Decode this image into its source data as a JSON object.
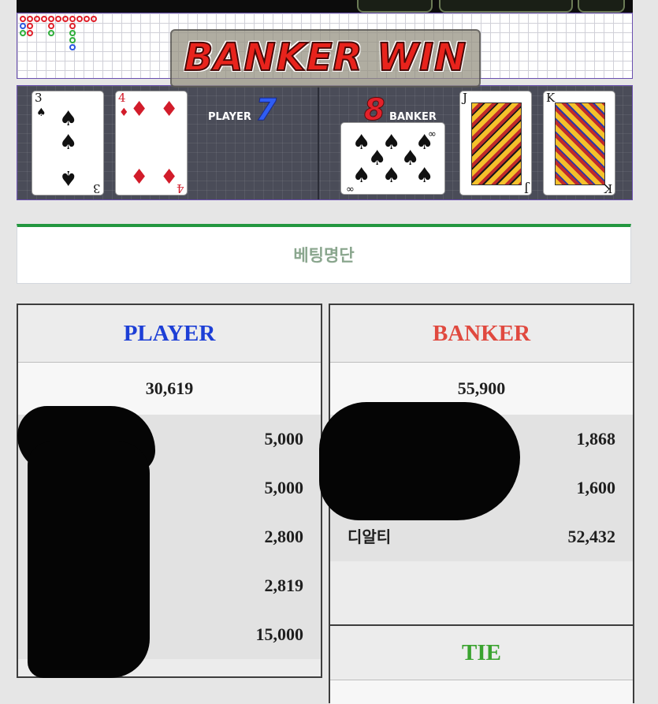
{
  "game": {
    "banner": "BANKER WIN",
    "player_label": "PLAYER",
    "player_score": "7",
    "banker_label": "BANKER",
    "banker_score": "8",
    "player_cards": [
      {
        "rank": "3",
        "suit": "♠",
        "color": "black"
      },
      {
        "rank": "4",
        "suit": "♦",
        "color": "red"
      }
    ],
    "banker_cards": [
      {
        "rank": "∞",
        "suit": "♠",
        "color": "black"
      },
      {
        "rank": "J",
        "suit": "♣",
        "color": "black"
      },
      {
        "rank": "K",
        "suit": "♣",
        "color": "black"
      }
    ]
  },
  "list_title": "베팅명단",
  "player_panel": {
    "header": "PLAYER",
    "header_color": "#1d3fd6",
    "total": "30,619",
    "rows": [
      {
        "name": "",
        "amount": "5,000"
      },
      {
        "name": "",
        "amount": "5,000"
      },
      {
        "name": "",
        "amount": "2,800"
      },
      {
        "name": "",
        "amount": "2,819"
      },
      {
        "name": "",
        "amount": "15,000"
      }
    ]
  },
  "banker_panel": {
    "header": "BANKER",
    "header_color": "#e0493f",
    "total": "55,900",
    "rows": [
      {
        "name": "",
        "amount": "1,868"
      },
      {
        "name": "",
        "amount": "1,600"
      },
      {
        "name": "디알티",
        "amount": "52,432"
      }
    ]
  },
  "tie_panel": {
    "header": "TIE",
    "header_color": "#3aa32f"
  }
}
